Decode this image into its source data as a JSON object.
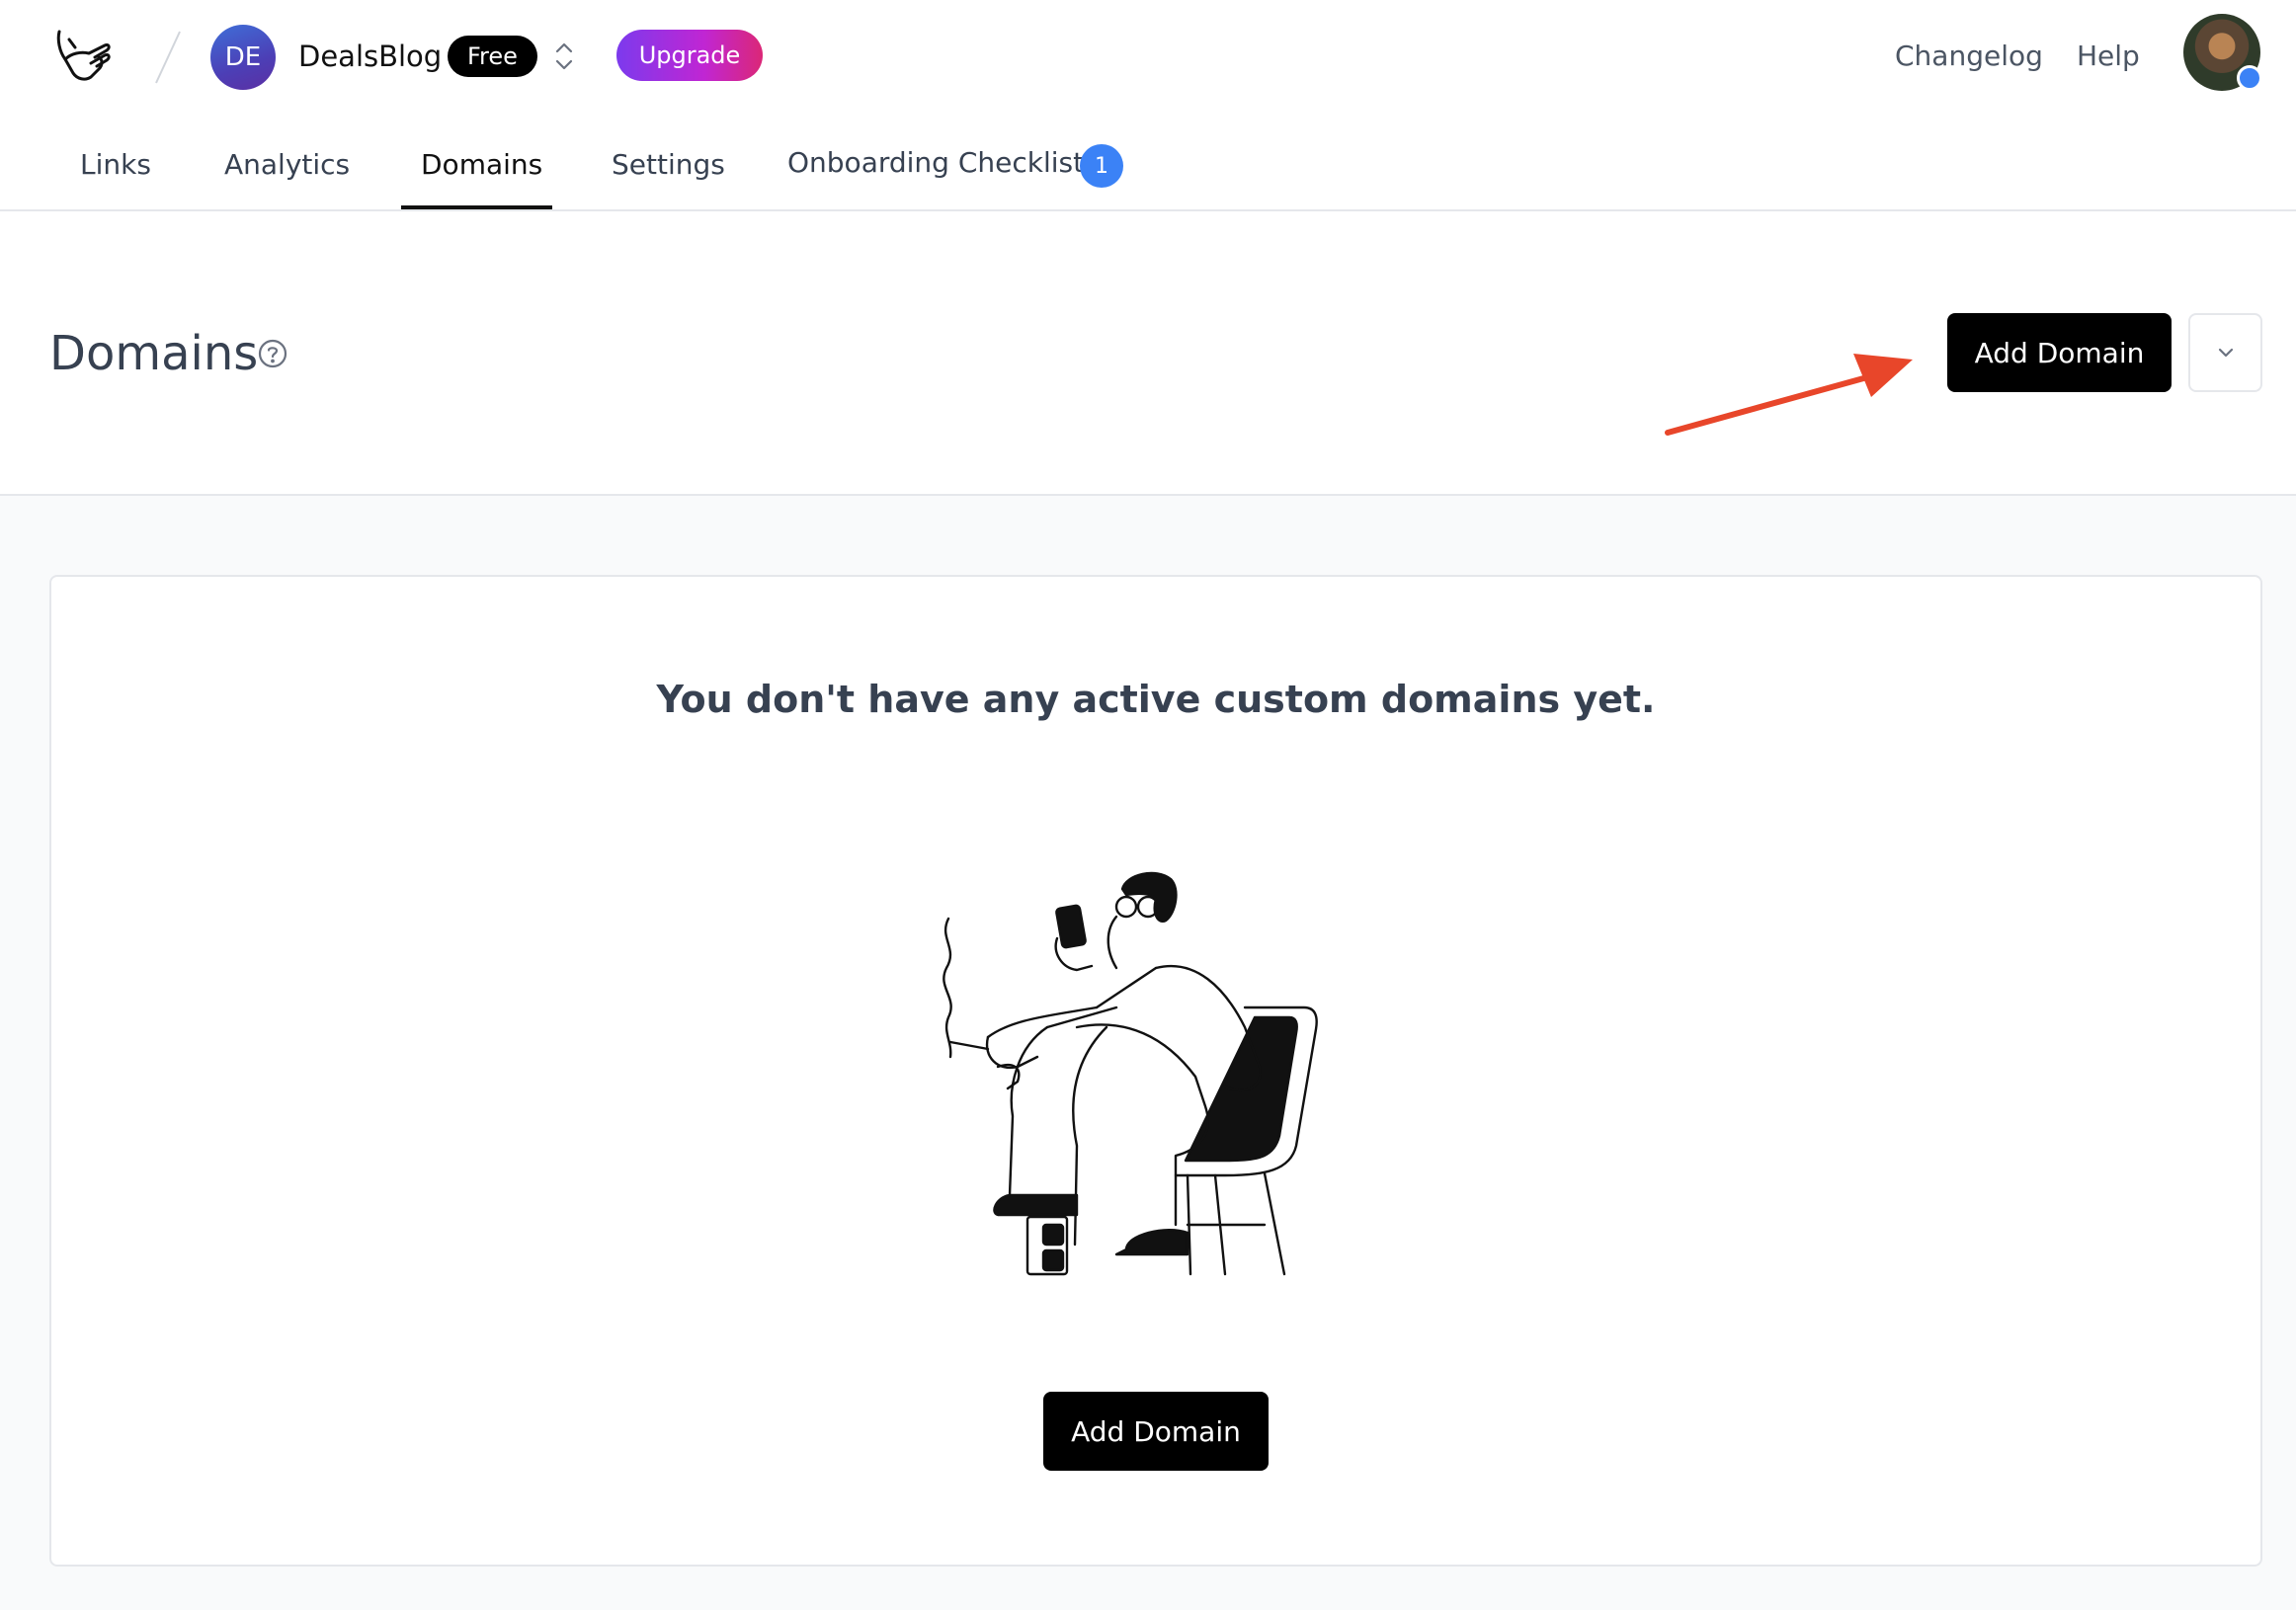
{
  "header": {
    "workspace_initials": "DE",
    "workspace_name": "DealsBlog",
    "plan_badge": "Free",
    "upgrade_label": "Upgrade",
    "links": [
      "Changelog",
      "Help"
    ]
  },
  "tabs": [
    {
      "label": "Links"
    },
    {
      "label": "Analytics"
    },
    {
      "label": "Domains",
      "active": true
    },
    {
      "label": "Settings"
    },
    {
      "label": "Onboarding Checklist",
      "badge": "1"
    }
  ],
  "page": {
    "title": "Domains",
    "add_button_label": "Add Domain"
  },
  "empty_state": {
    "message": "You don't have any active custom domains yet.",
    "button_label": "Add Domain"
  },
  "colors": {
    "accent_blue": "#3b82f6",
    "annotation_arrow": "#e8462a"
  },
  "icons": [
    "logo-icon",
    "chevrons-up-down-icon",
    "help-circle-icon",
    "chevron-down-icon"
  ]
}
